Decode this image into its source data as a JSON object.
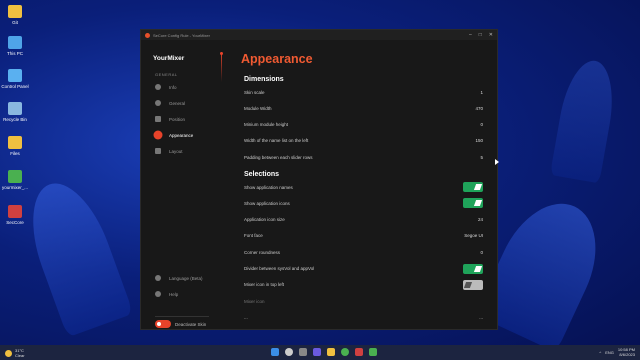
{
  "desktop": {
    "icons": [
      {
        "label": "Git",
        "color": "#f0c040",
        "icon": "folder-icon"
      },
      {
        "label": "This PC",
        "color": "#4fa4e8",
        "icon": "computer-icon"
      },
      {
        "label": "Control Panel",
        "color": "#5ab0f0",
        "icon": "control-panel-icon"
      },
      {
        "label": "Recycle Bin",
        "color": "#8ab8e0",
        "icon": "recycle-bin-icon"
      },
      {
        "label": "Files",
        "color": "#f0c040",
        "icon": "folder-icon"
      },
      {
        "label": "yourmixer_...",
        "color": "#4ab050",
        "icon": "mixer-icon"
      },
      {
        "label": "SecCore",
        "color": "#d04040",
        "icon": "app-icon"
      }
    ]
  },
  "window": {
    "title": "SeCore Config Rule - YourMixer",
    "controls": [
      "–",
      "□",
      "✕"
    ]
  },
  "sidebar": {
    "brand": "YourMixer",
    "section": "GENERAL",
    "items": [
      {
        "label": "Info",
        "icon": "info-icon"
      },
      {
        "label": "General",
        "icon": "gear-icon"
      },
      {
        "label": "Position",
        "icon": "grid-icon"
      },
      {
        "label": "Appearance",
        "icon": "palette-icon",
        "active": true
      },
      {
        "label": "Layout",
        "icon": "layout-icon"
      }
    ],
    "bottom": [
      {
        "label": "Language (Beta)",
        "icon": "globe-icon"
      },
      {
        "label": "Help",
        "icon": "help-icon"
      }
    ],
    "deactivate_label": "Deactivate Skin"
  },
  "main": {
    "title": "Appearance",
    "dimensions_heading": "Dimensions",
    "dimensions": [
      {
        "label": "Skin scale",
        "value": "1"
      },
      {
        "label": "Module Width",
        "value": "470"
      },
      {
        "label": "Minium module height",
        "value": "0"
      },
      {
        "label": "Width of the name list on the left",
        "value": "150"
      },
      {
        "label": "Padding between each slider rows",
        "value": "5"
      }
    ],
    "selections_heading": "Selections",
    "selections": [
      {
        "label": "Show application names",
        "toggle": "on"
      },
      {
        "label": "Show application icons",
        "toggle": "on"
      },
      {
        "label": "Application icon size",
        "value": "24"
      },
      {
        "label": "Font face",
        "value": "Segoe UI"
      },
      {
        "label": "Corner roundness",
        "value": "0"
      },
      {
        "label": "Divider between sysVol and appVol",
        "toggle": "on"
      },
      {
        "label": "Mixer icon in top left",
        "toggle": "off"
      },
      {
        "label": "Mixer icon",
        "muted": true
      },
      {
        "label": "...",
        "value": "..."
      }
    ]
  },
  "taskbar": {
    "weather_temp": "31°C",
    "weather_desc": "Clear",
    "lang": "ENG",
    "time": "10:58 PM",
    "date": "8/6/2023",
    "accent": "#e8432a",
    "toggle_on": "#1fa35a"
  }
}
